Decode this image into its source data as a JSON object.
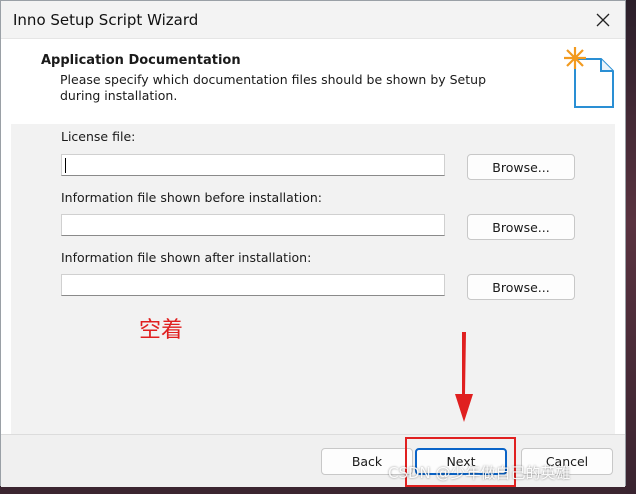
{
  "window": {
    "title": "Inno Setup Script Wizard"
  },
  "header": {
    "title": "Application Documentation",
    "description": "Please specify which documentation files should be shown by Setup during installation."
  },
  "fields": [
    {
      "label": "License file:",
      "value": "",
      "browse_label": "Browse..."
    },
    {
      "label": "Information file shown before installation:",
      "value": "",
      "browse_label": "Browse..."
    },
    {
      "label": "Information file shown after installation:",
      "value": "",
      "browse_label": "Browse..."
    }
  ],
  "annotation": {
    "note": "空着",
    "color": "#e02020"
  },
  "footer": {
    "back_label": "Back",
    "next_label": "Next",
    "cancel_label": "Cancel"
  },
  "watermark": "CSDN @少年做自己的英雄",
  "icons": {
    "close": "close-icon",
    "document": "document-star-icon"
  },
  "colors": {
    "accent": "#0a64c8",
    "annotation": "#e02020"
  }
}
